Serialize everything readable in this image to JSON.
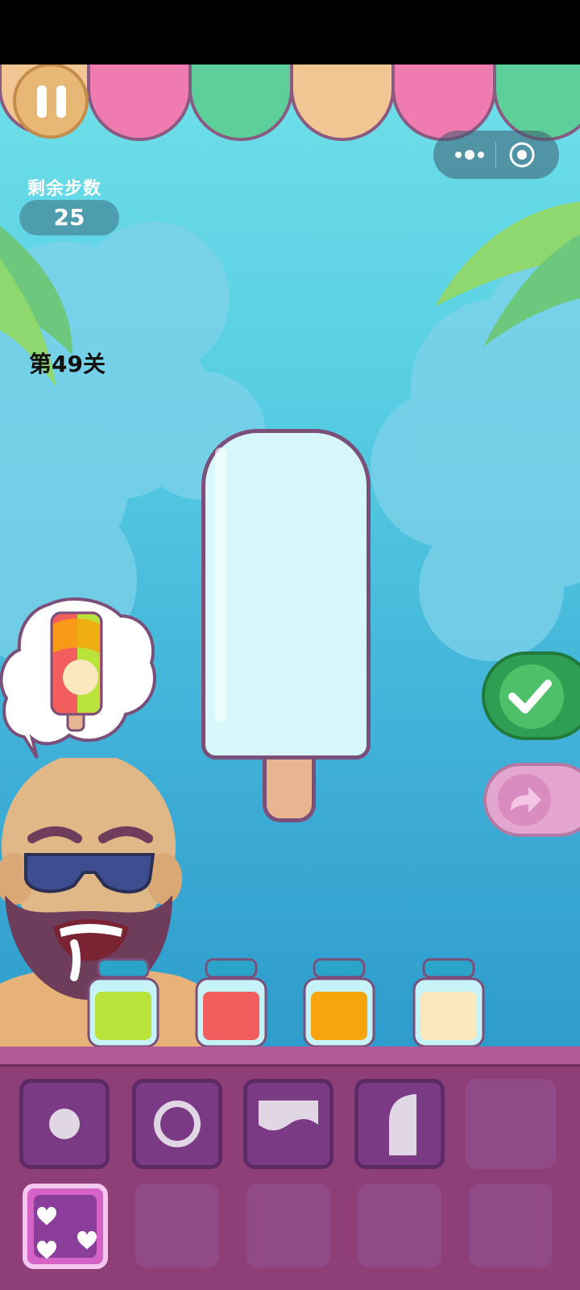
{
  "game": {
    "moves_remaining_label": "剩余步数",
    "moves_remaining": "25",
    "level_label": "第49关"
  },
  "colors": {
    "awning": [
      "#f07bb0",
      "#5ccf9a",
      "#f2c692",
      "#f07bb0",
      "#5ccf9a"
    ],
    "jars": [
      "#b9e33a",
      "#f25e5e",
      "#f7a50c",
      "#fbe8bf"
    ],
    "confirm": "#2f9e52",
    "skip": "#e4a6cf",
    "tray": "#8f3f78"
  },
  "jars": [
    {
      "icon": "lime-syrup-jar-icon"
    },
    {
      "icon": "red-syrup-jar-icon"
    },
    {
      "icon": "orange-syrup-jar-icon"
    },
    {
      "icon": "cream-syrup-jar-icon"
    }
  ],
  "tray_slots": [
    {
      "icon": "small-dot-mold-icon"
    },
    {
      "icon": "ring-mold-icon"
    },
    {
      "icon": "wave-top-mold-icon"
    },
    {
      "icon": "half-moon-mold-icon"
    },
    {
      "icon": "empty"
    },
    {
      "icon": "hearts-mold-icon",
      "selected": true
    },
    {
      "icon": "empty"
    },
    {
      "icon": "empty"
    },
    {
      "icon": "empty"
    },
    {
      "icon": "empty"
    }
  ],
  "icons": {
    "pause": "pause-icon",
    "more": "more-icon",
    "close": "close-target-icon",
    "confirm": "checkmark-icon",
    "skip": "arrow-redo-icon"
  }
}
